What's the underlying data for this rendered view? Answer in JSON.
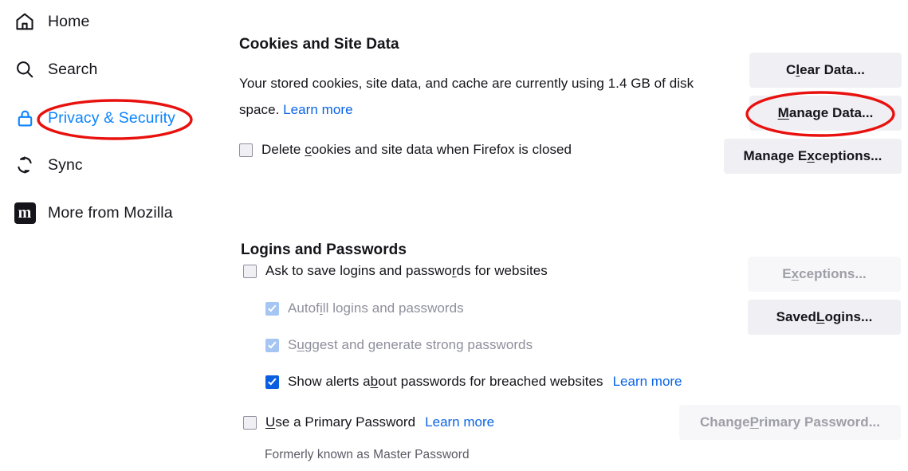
{
  "sidebar": {
    "items": [
      {
        "id": "home",
        "label": "Home",
        "icon": "home-icon",
        "selected": false
      },
      {
        "id": "search",
        "label": "Search",
        "icon": "search-icon",
        "selected": false
      },
      {
        "id": "privacy",
        "label": "Privacy & Security",
        "icon": "lock-icon",
        "selected": true
      },
      {
        "id": "sync",
        "label": "Sync",
        "icon": "sync-icon",
        "selected": false
      },
      {
        "id": "mozilla",
        "label": "More from Mozilla",
        "icon": "mozilla-m-icon",
        "selected": false
      }
    ]
  },
  "cookies_section": {
    "title": "Cookies and Site Data",
    "description_before": "Your stored cookies, site data, and cache are currently using 1.4 GB of disk space.",
    "storage_size": "1.4 GB",
    "learn_more": "Learn more",
    "delete_on_close": {
      "label_pre": "Delete ",
      "accesskey": "c",
      "label_post": "ookies and site data when Firefox is closed",
      "checked": false,
      "disabled": false
    },
    "buttons": [
      {
        "id": "clear-data",
        "pre": "C",
        "accesskey": "l",
        "post": "ear Data...",
        "disabled": false
      },
      {
        "id": "manage-data",
        "pre": "",
        "accesskey": "M",
        "post": "anage Data...",
        "disabled": false
      },
      {
        "id": "manage-exceptions",
        "pre": "Manage E",
        "accesskey": "x",
        "post": "ceptions...",
        "disabled": false
      }
    ]
  },
  "logins_section": {
    "title": "Logins and Passwords",
    "checkboxes": [
      {
        "id": "ask-save",
        "label_pre": "Ask to save logins and passwo",
        "accesskey": "r",
        "label_post": "ds for websites",
        "checked": false,
        "disabled": false,
        "indent": 0,
        "learn_more": null
      },
      {
        "id": "autofill",
        "label_pre": "Autof",
        "accesskey": "i",
        "label_post": "ll logins and passwords",
        "checked": true,
        "disabled": true,
        "indent": 1,
        "learn_more": null
      },
      {
        "id": "suggest-strong",
        "label_pre": "S",
        "accesskey": "u",
        "label_post": "ggest and generate strong passwords",
        "checked": true,
        "disabled": true,
        "indent": 1,
        "learn_more": null
      },
      {
        "id": "breach-alerts",
        "label_pre": "Show alerts a",
        "accesskey": "b",
        "label_post": "out passwords for breached websites",
        "checked": true,
        "disabled": false,
        "indent": 1,
        "learn_more": "Learn more"
      },
      {
        "id": "primary-password",
        "label_pre": "",
        "accesskey": "U",
        "label_post": "se a Primary Password",
        "checked": false,
        "disabled": false,
        "indent": 0,
        "learn_more": "Learn more"
      }
    ],
    "primary_password_note": "Formerly known as Master Password",
    "buttons": [
      {
        "id": "exceptions",
        "pre": "E",
        "accesskey": "x",
        "post": "ceptions...",
        "disabled": true
      },
      {
        "id": "saved-logins",
        "pre": "Saved ",
        "accesskey": "L",
        "post": "ogins...",
        "disabled": false
      },
      {
        "id": "change-primary",
        "pre": "Change ",
        "accesskey": "P",
        "post": "rimary Password...",
        "disabled": true
      }
    ]
  },
  "annotations": {
    "color": "#e8110e",
    "ellipses": [
      {
        "id": "privacy-security-highlight",
        "target": "sidebar-item-privacy"
      },
      {
        "id": "manage-data-highlight",
        "target": "manage-data-button"
      }
    ]
  },
  "colors": {
    "accent_link": "#0a64e6",
    "selected_nav": "#0a84ff",
    "checkbox_checked": "#0a5ee0",
    "checkbox_checked_disabled": "#a5c6f2",
    "button_bg": "#f0f0f4",
    "text": "#15141a",
    "text_muted": "#8f8f9d",
    "annotation_red": "#e8110e"
  }
}
